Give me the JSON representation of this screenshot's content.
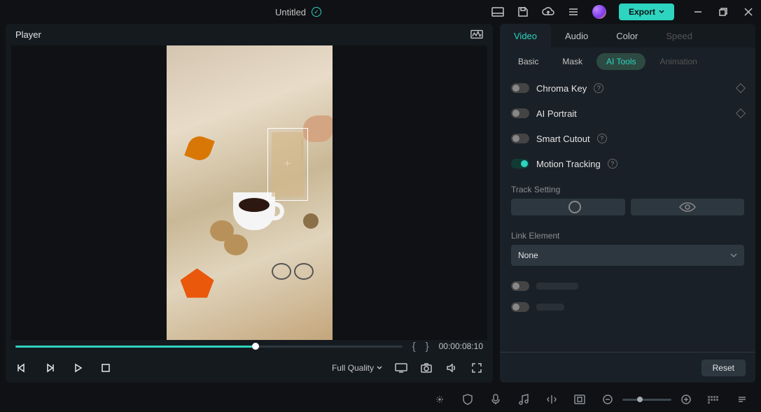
{
  "titlebar": {
    "title": "Untitled",
    "export": "Export"
  },
  "player": {
    "label": "Player",
    "timecode": "00:00:08:10",
    "quality": "Full Quality"
  },
  "tabs": {
    "main": {
      "video": "Video",
      "audio": "Audio",
      "color": "Color",
      "speed": "Speed"
    },
    "sub": {
      "basic": "Basic",
      "mask": "Mask",
      "ai_tools": "AI Tools",
      "animation": "Animation"
    }
  },
  "tools": {
    "chroma": "Chroma Key",
    "portrait": "AI Portrait",
    "cutout": "Smart Cutout",
    "motion": "Motion Tracking"
  },
  "track_setting": "Track Setting",
  "link_element": {
    "label": "Link Element",
    "value": "None"
  },
  "reset": "Reset"
}
